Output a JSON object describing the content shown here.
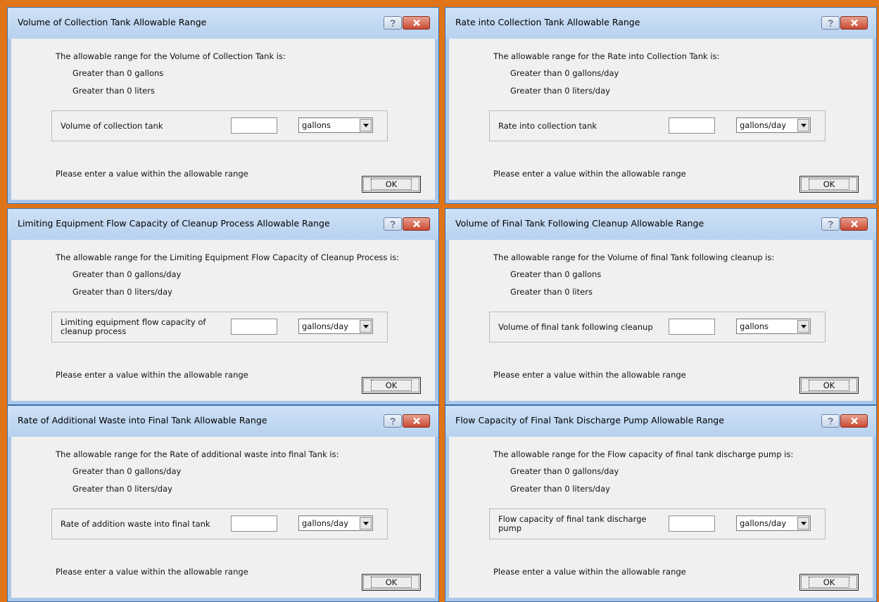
{
  "dialogs": [
    {
      "title": "Volume of Collection Tank Allowable Range",
      "intro": "The allowable range for the Volume of Collection Tank is:",
      "range_us": "Greater than 0 gallons",
      "range_metric": "Greater than 0 liters",
      "field_label": "Volume of collection tank",
      "input_value": "",
      "unit": "gallons",
      "hint": "Please enter a value within the allowable range",
      "ok_label": "OK"
    },
    {
      "title": "Rate into Collection Tank Allowable Range",
      "intro": "The allowable range for the Rate into Collection Tank is:",
      "range_us": "Greater than 0 gallons/day",
      "range_metric": "Greater than 0 liters/day",
      "field_label": "Rate into collection tank",
      "input_value": "",
      "unit": "gallons/day",
      "hint": "Please enter a value within the allowable range",
      "ok_label": "OK"
    },
    {
      "title": "Limiting Equipment Flow Capacity of Cleanup Process Allowable Range",
      "intro": "The allowable range for the Limiting Equipment Flow Capacity of Cleanup Process is:",
      "range_us": "Greater than 0 gallons/day",
      "range_metric": "Greater than 0 liters/day",
      "field_label": "Limiting equipment flow capacity of cleanup process",
      "input_value": "",
      "unit": "gallons/day",
      "hint": "Please enter a value within the allowable range",
      "ok_label": "OK"
    },
    {
      "title": "Volume of Final Tank Following Cleanup Allowable Range",
      "intro": "The allowable range for the Volume of final Tank following cleanup is:",
      "range_us": "Greater than 0 gallons",
      "range_metric": "Greater than 0 liters",
      "field_label": "Volume of final tank following cleanup",
      "input_value": "",
      "unit": "gallons",
      "hint": "Please enter a value within the allowable range",
      "ok_label": "OK"
    },
    {
      "title": "Rate of Additional Waste into Final Tank Allowable Range",
      "intro": "The allowable range for the Rate of additional waste into final Tank is:",
      "range_us": "Greater than 0 gallons/day",
      "range_metric": "Greater than 0 liters/day",
      "field_label": "Rate of addition waste into final tank",
      "input_value": "",
      "unit": "gallons/day",
      "hint": "Please enter a value within the allowable range",
      "ok_label": "OK"
    },
    {
      "title": "Flow Capacity of Final Tank Discharge Pump Allowable Range",
      "intro": "The allowable range for the Flow capacity of final tank discharge pump is:",
      "range_us": "Greater than 0 gallons/day",
      "range_metric": "Greater than 0 liters/day",
      "field_label": "Flow capacity of final tank discharge pump",
      "input_value": "",
      "unit": "gallons/day",
      "hint": "Please enter a value within the allowable range",
      "ok_label": "OK"
    }
  ],
  "icons": {
    "help": "help-icon",
    "close": "close-icon",
    "dropdown": "dropdown-arrow-icon"
  },
  "colors": {
    "background": "#e07418",
    "titlebar": "#b7d1ef",
    "close_button": "#c94a33"
  }
}
